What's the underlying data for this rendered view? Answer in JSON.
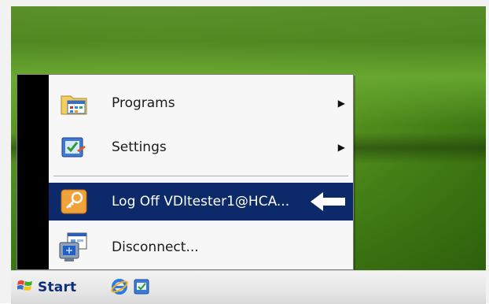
{
  "start_menu": {
    "items": [
      {
        "label": "Programs",
        "icon": "programs-folder-icon",
        "has_submenu": true
      },
      {
        "label": "Settings",
        "icon": "settings-icon",
        "has_submenu": true
      },
      {
        "label": "Log Off VDItester1@HCA...",
        "icon": "logoff-key-icon",
        "has_submenu": false,
        "highlighted": true
      },
      {
        "label": "Disconnect...",
        "icon": "disconnect-icon",
        "has_submenu": false
      }
    ]
  },
  "taskbar": {
    "start_label": "Start",
    "quick_launch": [
      "internet-explorer-icon",
      "show-desktop-icon"
    ]
  },
  "colors": {
    "highlight": "#0c2a6a",
    "menu_bg": "#f7f7f7",
    "rail": "#000000",
    "taskbar": "#e6e6e6"
  }
}
